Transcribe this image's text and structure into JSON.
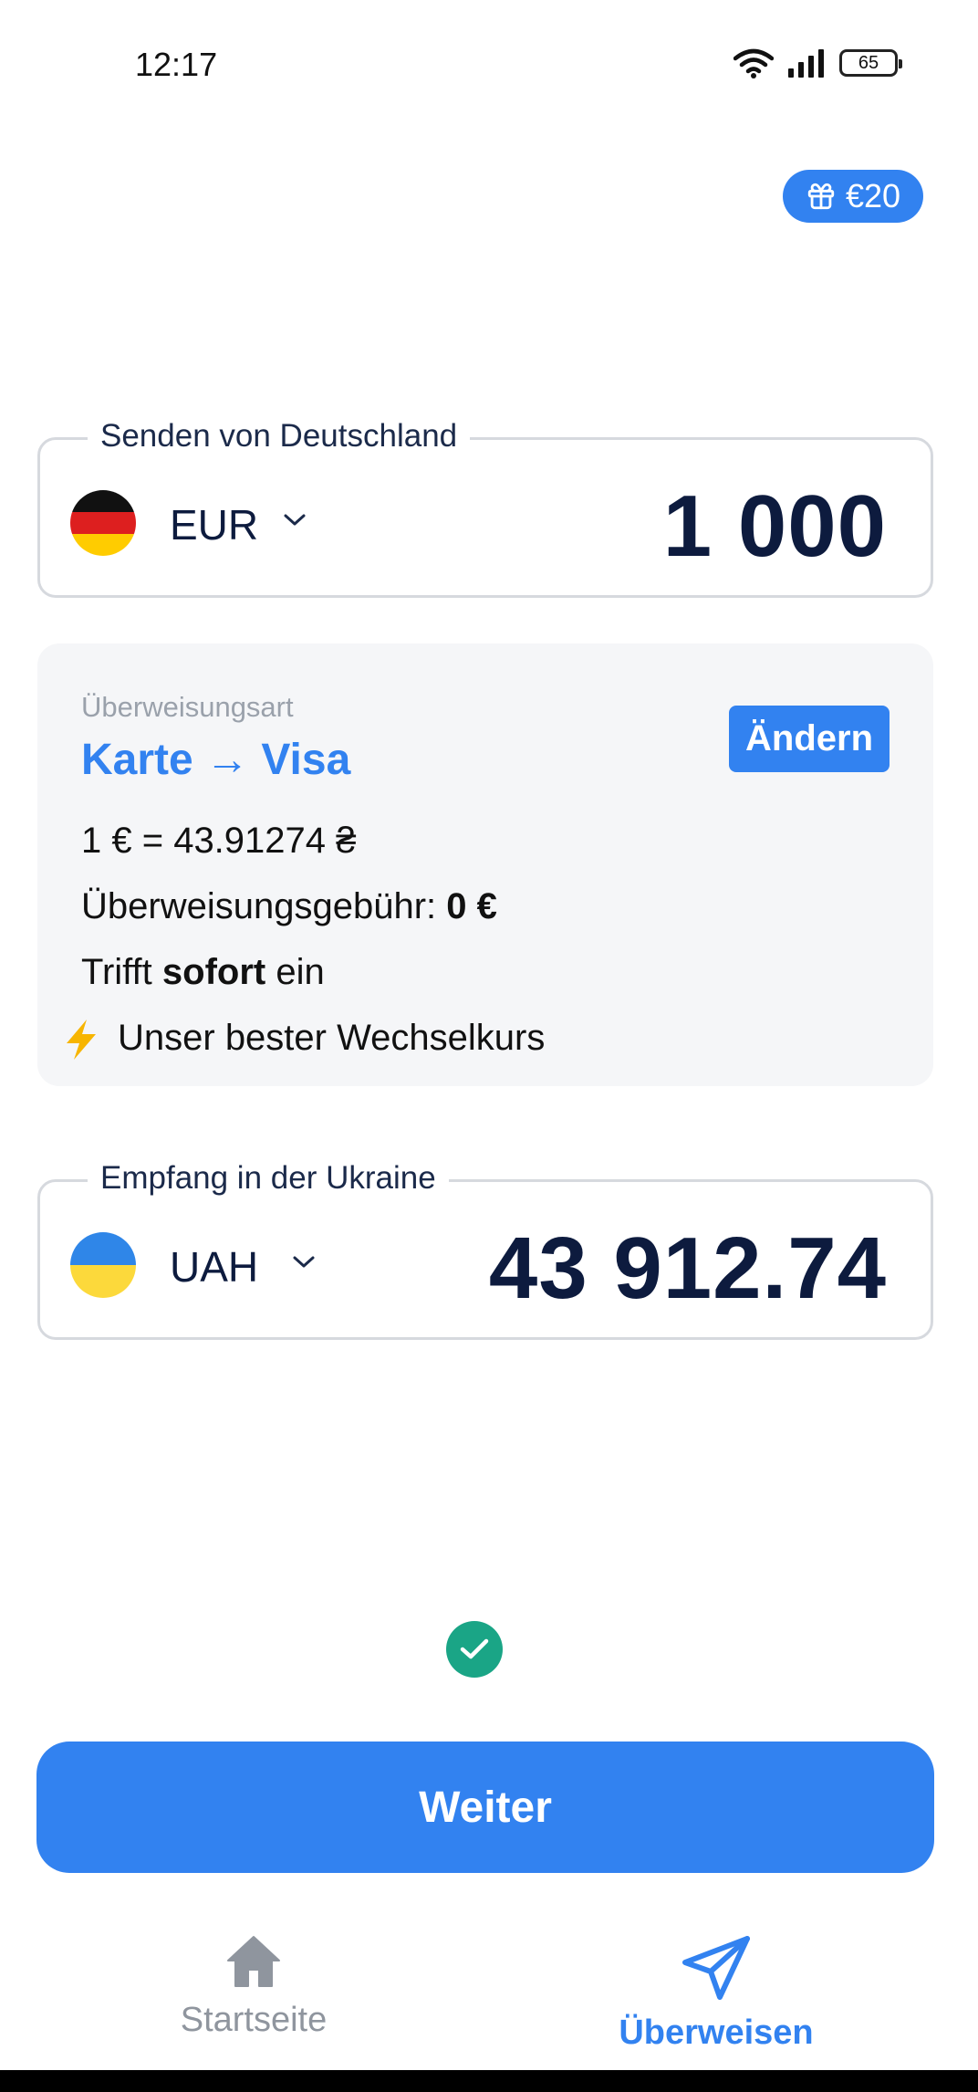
{
  "status_bar": {
    "time": "12:17",
    "battery": "65"
  },
  "gift_badge": {
    "label": "€20"
  },
  "send": {
    "label": "Senden von Deutschland",
    "currency": "EUR",
    "amount": "1 000"
  },
  "transfer": {
    "type_label": "Überweisungsart",
    "type_value": "Karte → Visa",
    "change_button": "Ändern",
    "rate": "1 € = 43.91274 ₴",
    "fee_label": "Überweisungsgebühr:",
    "fee_value": "0 €",
    "arrival_prefix": "Trifft",
    "arrival_bold": "sofort",
    "arrival_suffix": "ein",
    "best_rate": "Unser bester Wechselkurs"
  },
  "receive": {
    "label": "Empfang in der Ukraine",
    "currency": "UAH",
    "amount": "43 912.74"
  },
  "next_button": "Weiter",
  "nav": {
    "home": "Startseite",
    "transfer": "Überweisen"
  },
  "colors": {
    "accent": "#3282f0",
    "text_dark": "#0d1b3e",
    "success": "#1aa586"
  }
}
